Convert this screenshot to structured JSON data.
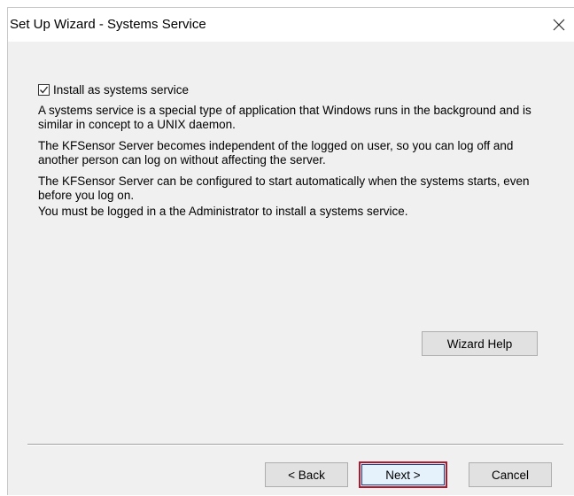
{
  "window": {
    "title": "Set Up Wizard - Systems Service",
    "close_glyph": "✕"
  },
  "install_option": {
    "label": "Install as systems service",
    "checked": true
  },
  "paragraphs": [
    "A systems service is a special type of application that Windows runs in the background and is similar in concept to a UNIX daemon.",
    "The KFSensor Server becomes independent of the logged on user, so you can log off and another person can log on without affecting the server.",
    "The KFSensor Server can be configured to start automatically when the systems starts, even before you log on.",
    "You must be logged in a the Administrator to install a systems service."
  ],
  "buttons": {
    "wizard_help": "Wizard Help",
    "back": "< Back",
    "next": "Next >",
    "cancel": "Cancel"
  },
  "colors": {
    "dialog_bg": "#f0f0f0",
    "highlight_border": "#b3172e"
  },
  "icons": {
    "close": "close-icon",
    "checkmark": "checkmark-icon"
  }
}
